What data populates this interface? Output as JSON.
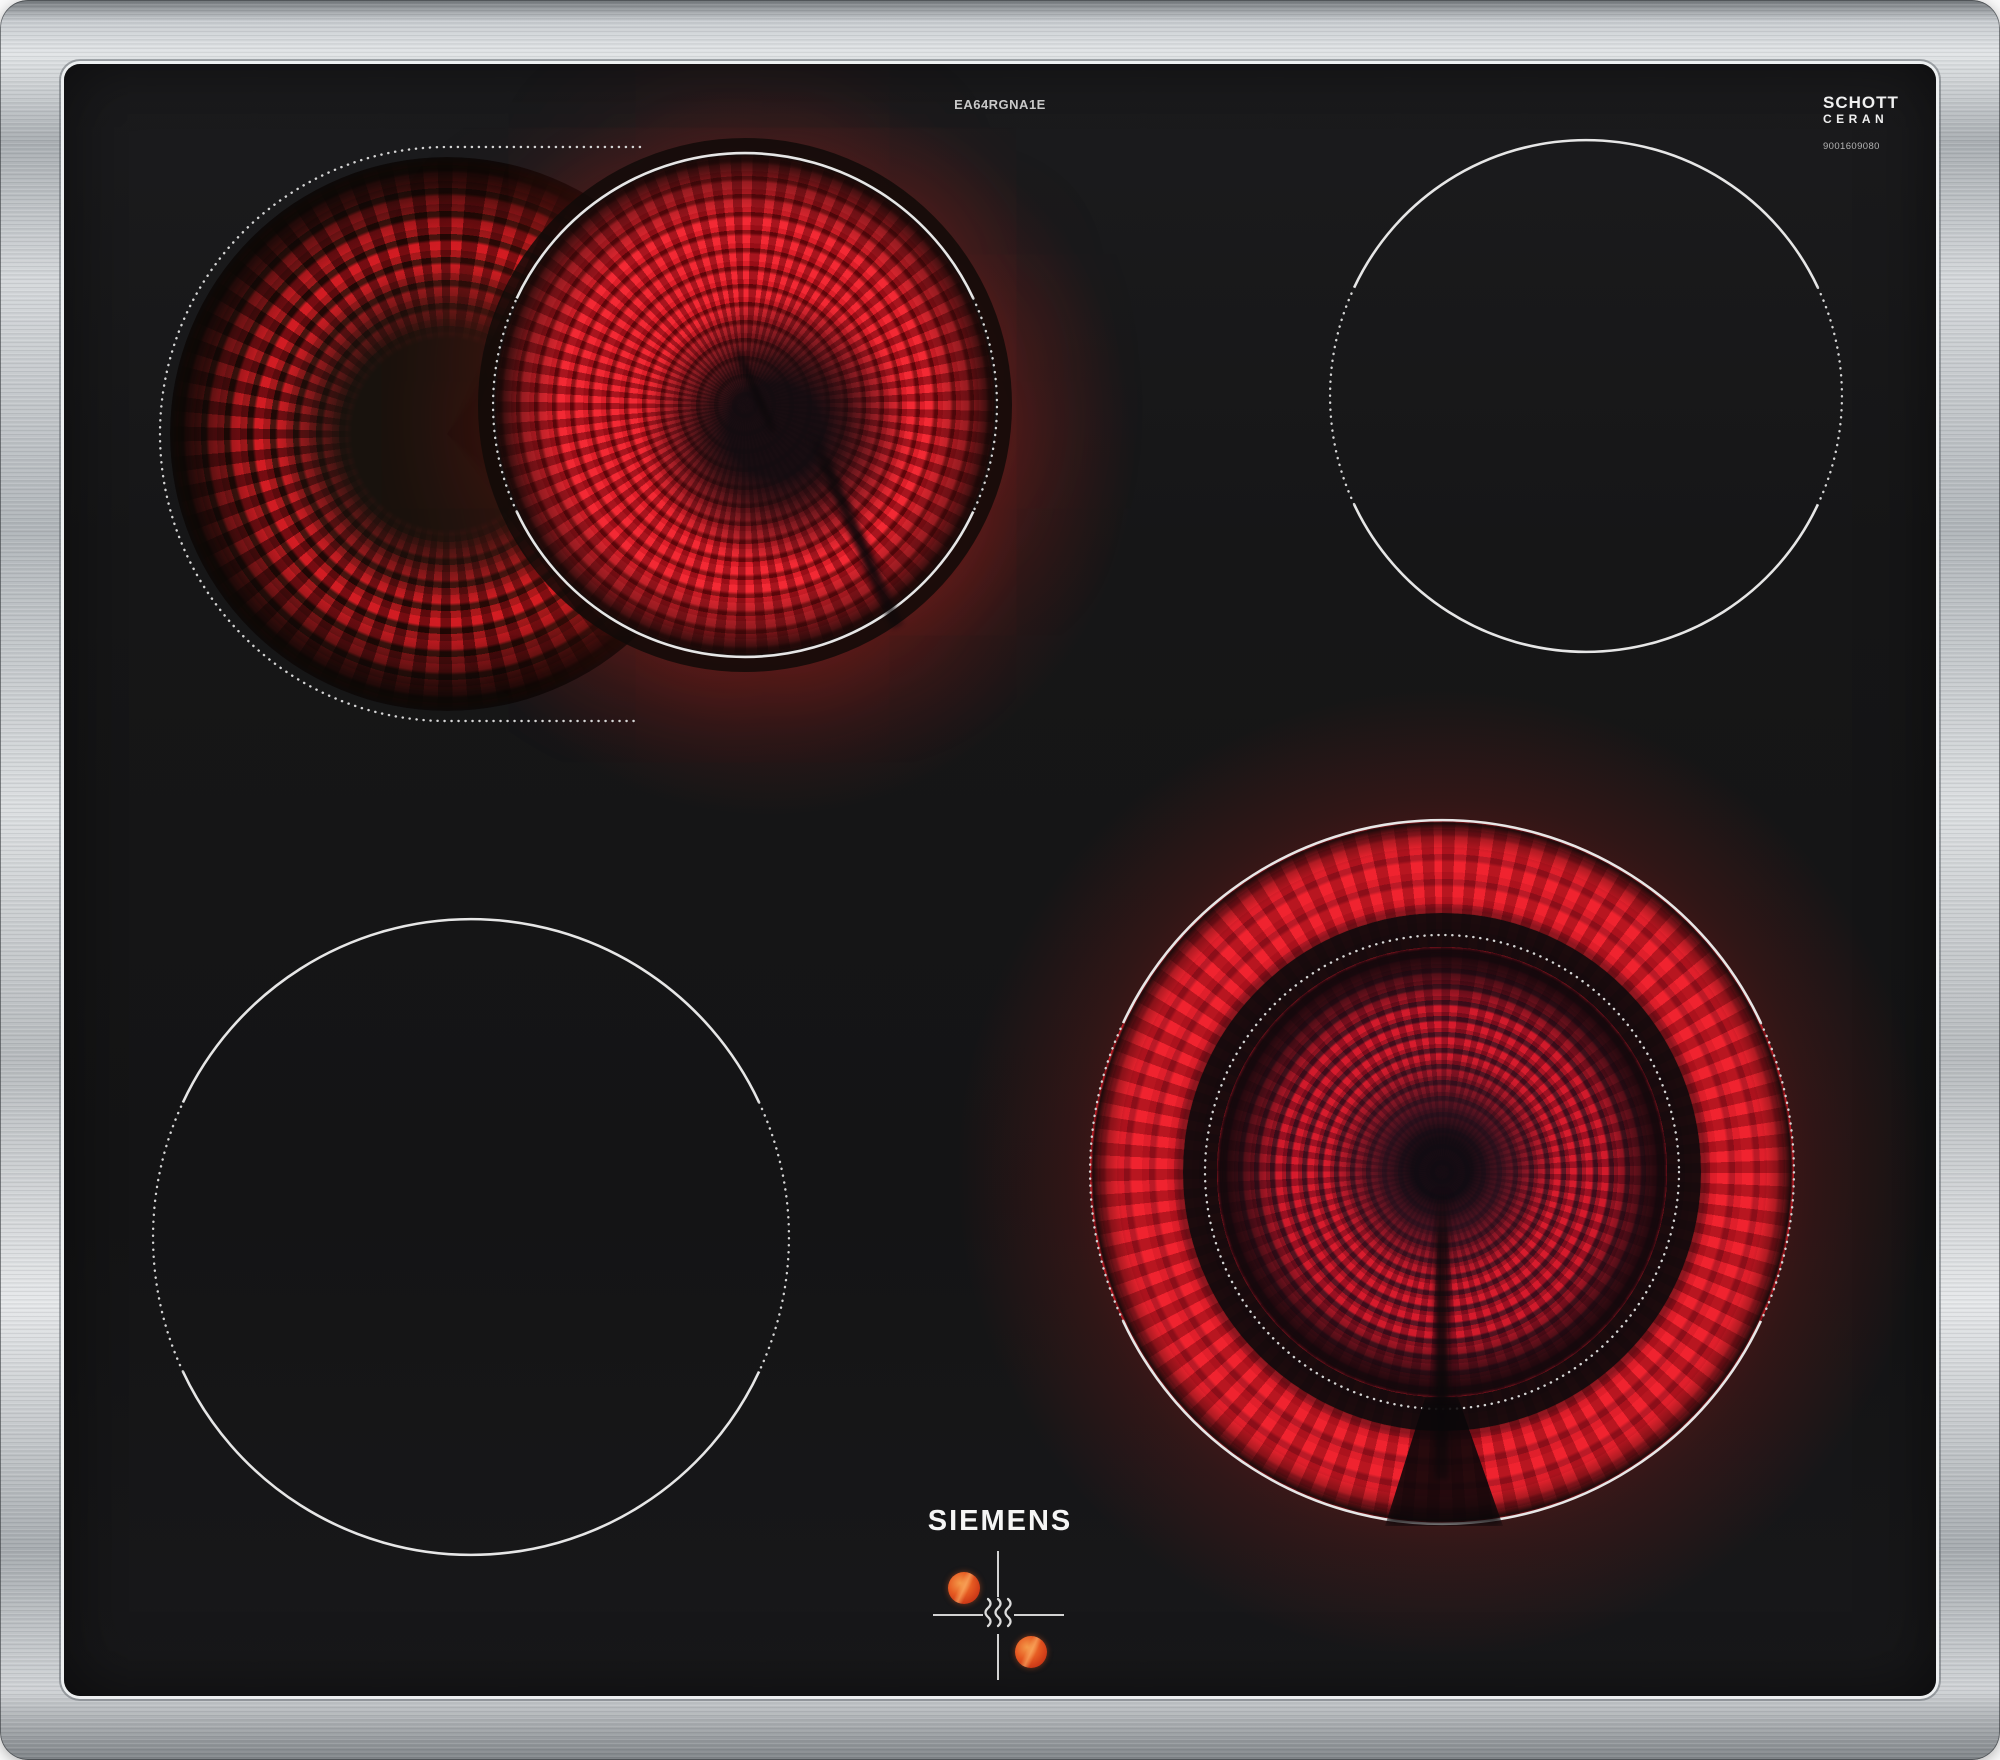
{
  "branding": {
    "manufacturer": "SIEMENS",
    "model_code": "EA64RGNA1E",
    "glass": {
      "maker": "SCHOTT",
      "product_line": "CERAN",
      "print_number": "9001609080"
    }
  },
  "surface": {
    "description": "glass-ceramic hob with 4 radiant cooking zones and stainless steel frame",
    "colors": {
      "glass_black": "#161617",
      "frame_steel": "#c3c7cb",
      "glow_bright_red": "#e31b2b",
      "glow_dark_red": "#7e0a12",
      "zone_outline_white": "#e6e6e6",
      "residual_heat_orange": "#e65a22"
    }
  },
  "zones": [
    {
      "id": "rear-left-extension",
      "outline": "dotted stadium (oval roaster extension)",
      "state": "heating-low-glow"
    },
    {
      "id": "rear-left-main",
      "outline": "solid/dotted circle",
      "state": "heating-bright-glow"
    },
    {
      "id": "rear-right",
      "outline": "solid/dotted circle",
      "state": "off"
    },
    {
      "id": "front-left",
      "outline": "solid/dotted circle",
      "state": "off"
    },
    {
      "id": "front-right",
      "outline": "dual-circuit circle with inner dotted ring",
      "state": "heating-bright-glow"
    }
  ],
  "residual_heat_indicator": {
    "icon": "heat-waves-icon",
    "layout": "crosshair of four hotplate positions",
    "hot_positions": [
      "rear-left",
      "front-right"
    ]
  }
}
